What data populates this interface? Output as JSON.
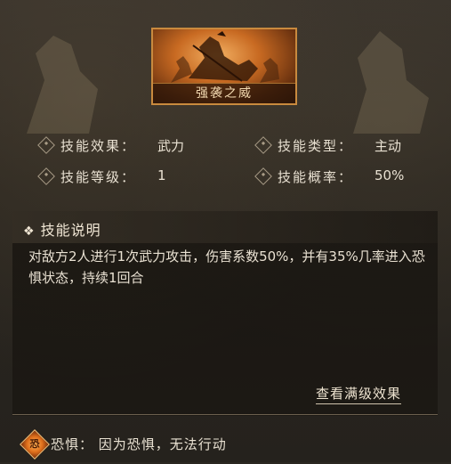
{
  "skill": {
    "name": "强袭之威"
  },
  "info": {
    "effect_label": "技能效果：",
    "effect_value": "武力",
    "type_label": "技能类型：",
    "type_value": "主动",
    "level_label": "技能等级：",
    "level_value": "1",
    "chance_label": "技能概率：",
    "chance_value": "50%"
  },
  "description": {
    "title_symbol": "❖",
    "title": "技能说明",
    "text": "对敌方2人进行1次武力攻击，伤害系数50%，并有35%几率进入恐惧状态，持续1回合",
    "full_level_link": "查看满级效果"
  },
  "status": {
    "icon": "fear-status-icon",
    "icon_glyph": "恐",
    "text": "恐惧：  因为恐惧，无法行动"
  },
  "colors": {
    "accent_orange": "#e0701c",
    "card_border": "#c98a3e",
    "text": "#e9e1d2"
  }
}
